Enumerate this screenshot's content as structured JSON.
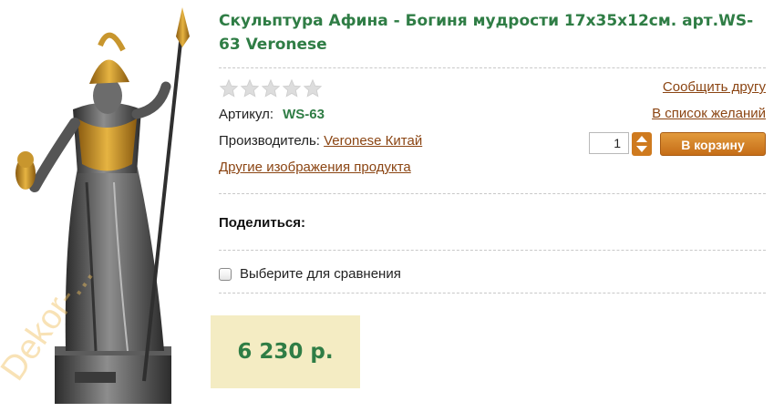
{
  "product": {
    "title": "Скульптура Афина - Богиня мудрости 17x35x12см. арт.WS-63 Veronese",
    "rating_stars": 5,
    "rating_value": 0,
    "article_label": "Артикул:",
    "article_value": "WS-63",
    "manufacturer_label": "Производитель:",
    "manufacturer_value": "Veronese Китай",
    "other_images_link": "Другие изображения продукта",
    "watermark": "Dekor-..."
  },
  "actions": {
    "tell_friend": "Сообщить другу",
    "wishlist": "В список желаний",
    "quantity": "1",
    "add_to_cart": "В корзину"
  },
  "share_label": "Поделиться:",
  "compare_label": "Выберите для сравнения",
  "price": "6 230 р.",
  "colors": {
    "title_green": "#2f7d45",
    "link_brown": "#8b4513",
    "cart_button": "#d58128",
    "price_bg": "#f4ecc3"
  }
}
